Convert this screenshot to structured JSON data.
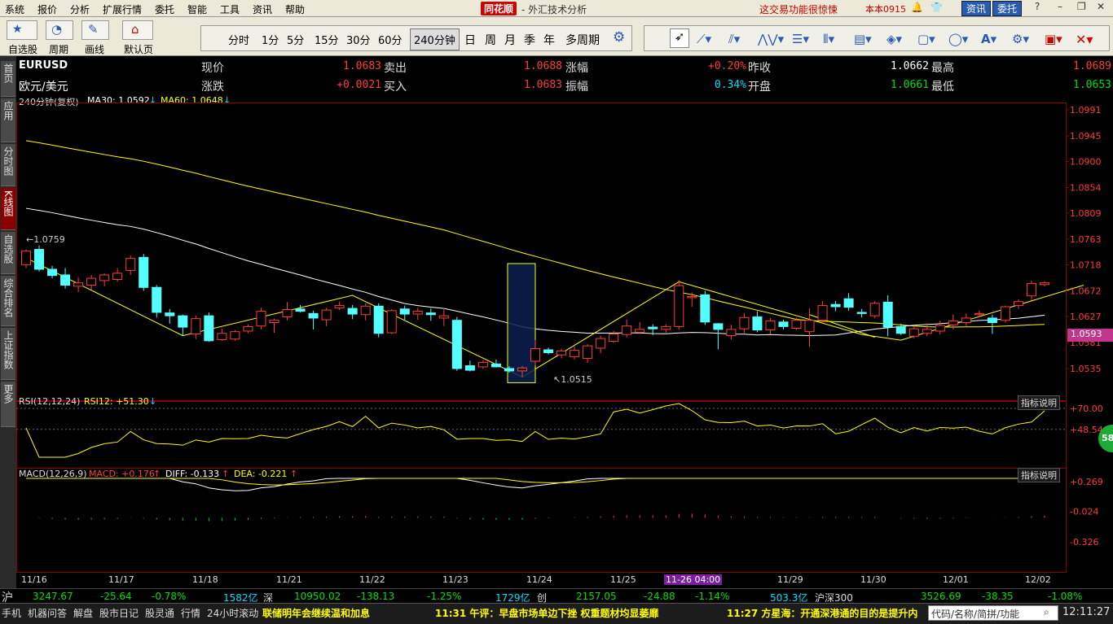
{
  "menubar": {
    "items": [
      "系统",
      "报价",
      "分析",
      "扩展行情",
      "委托",
      "智能",
      "工具",
      "资讯",
      "帮助"
    ],
    "logo": "同花顺",
    "subtitle": "- 外汇技术分析",
    "ad_text": "这交易功能很惊悚",
    "version": "本本0915",
    "btn_news": "资讯",
    "btn_trade": "委托"
  },
  "toolbar": {
    "self_select": "自选股",
    "period": "周期",
    "draw": "画线",
    "default_page": "默认页",
    "periods": [
      "分时",
      "1分",
      "5分",
      "15分",
      "30分",
      "60分",
      "240分钟",
      "日",
      "周",
      "月",
      "季",
      "年",
      "多周期"
    ],
    "active_period": "240分钟"
  },
  "sidebar": {
    "tabs": [
      "首页",
      "应用",
      "分时图",
      "K线图",
      "自选股",
      "综合排名",
      "上证指数",
      "更多"
    ],
    "active": "K线图"
  },
  "quote": {
    "symbol": "EURUSD",
    "name": "欧元/美元",
    "labels": [
      "现价",
      "卖出",
      "涨幅",
      "昨收",
      "最高",
      "涨跌",
      "买入",
      "振幅",
      "开盘",
      "最低"
    ],
    "price": "1.0683",
    "sell": "1.0688",
    "change_pct": "+0.20%",
    "prev_close": "1.0662",
    "high": "1.0689",
    "change": "+0.0021",
    "buy": "1.0683",
    "amplitude": "0.34%",
    "open": "1.0661",
    "low": "1.0653"
  },
  "kline": {
    "header": "240分钟(复权)",
    "ma30": "MA30: 1.0592",
    "ma60": "MA60: 1.0648",
    "marker_high": "1.0759",
    "marker_low": "1.0515",
    "price_ticks": [
      "1.0991",
      "1.0945",
      "1.0900",
      "1.0854",
      "1.0809",
      "1.0763",
      "1.0718",
      "1.0672",
      "1.0627",
      "1.0581",
      "1.0535"
    ],
    "current_price_tag": "1.0593",
    "colors": {
      "up": "#ff3c3c",
      "down": "#54ffff",
      "ma30": "#ffffff",
      "ma60": "#ffff00"
    }
  },
  "rsi": {
    "label": "RSI(12,12,24)",
    "value": "RSI12: +51.30",
    "explain": "指标说明",
    "ticks": [
      "+70.00",
      "+48.54"
    ],
    "badge": "58"
  },
  "macd": {
    "label": "MACD(12,26,9)",
    "macd": "MACD: +0.176",
    "diff": "DIFF: -0.133",
    "dea": "DEA: -0.221",
    "explain": "指标说明",
    "ticks": [
      "+0.269",
      "-0.024",
      "-0.326"
    ]
  },
  "dates": [
    "11/16",
    "11/17",
    "11/18",
    "11/21",
    "11/22",
    "11/23",
    "11/24",
    "11/25",
    "11-26 04:00",
    "11/29",
    "11/30",
    "12/01",
    "12/02"
  ],
  "status1": {
    "sh_label": "沪",
    "sh_index": "3247.67",
    "sh_chg": "-25.64",
    "sh_pct": "-0.78%",
    "sh_amt": "1582亿",
    "sz_label": "深",
    "sz_index": "10950.02",
    "sz_chg": "-138.13",
    "sz_pct": "-1.25%",
    "sz_amt": "1729亿",
    "cy_label": "创",
    "cy_index": "2157.05",
    "cy_chg": "-24.88",
    "cy_pct": "-1.14%",
    "cy_amt": "503.3亿",
    "hs_label": "沪深300",
    "hs_index": "3526.69",
    "hs_chg": "-38.35",
    "hs_pct": "-1.08%"
  },
  "status2": {
    "tabs": [
      "手机",
      "机器问答",
      "解盘",
      "股市日记",
      "股灵通",
      "行情",
      "24小时滚动"
    ],
    "news1": "联储明年会继续温和加息",
    "news2": "11:31 午评：早盘市场单边下挫 权重题材均显萎靡",
    "news3": "11:27 方星海：开通深港通的目的是提升内",
    "search": "代码/名称/简拼/功能",
    "clock": "12:11:27"
  },
  "candles": [
    [
      1.0718,
      1.0745,
      1.0712,
      1.0742
    ],
    [
      1.0745,
      1.0752,
      1.0706,
      1.071
    ],
    [
      1.071,
      1.0716,
      1.0694,
      1.0699
    ],
    [
      1.07,
      1.0712,
      1.0676,
      1.0682
    ],
    [
      1.068,
      1.0696,
      1.067,
      1.0686
    ],
    [
      1.0682,
      1.07,
      1.0674,
      1.0694
    ],
    [
      1.069,
      1.0703,
      1.068,
      1.07
    ],
    [
      1.0692,
      1.0712,
      1.0688,
      1.0703
    ],
    [
      1.0708,
      1.0734,
      1.07,
      1.0729
    ],
    [
      1.0731,
      1.0737,
      1.0672,
      1.0678
    ],
    [
      1.0678,
      1.0682,
      1.0625,
      1.0634
    ],
    [
      1.0633,
      1.064,
      1.0614,
      1.0628
    ],
    [
      1.0628,
      1.063,
      1.0593,
      1.0608
    ],
    [
      1.0596,
      1.0628,
      1.0587,
      1.0623
    ],
    [
      1.0628,
      1.0634,
      1.0582,
      1.0584
    ],
    [
      1.0586,
      1.0605,
      1.0584,
      1.0597
    ],
    [
      1.0587,
      1.0603,
      1.0584,
      1.06
    ],
    [
      1.0601,
      1.0613,
      1.0597,
      1.0609
    ],
    [
      1.061,
      1.0642,
      1.0604,
      1.0636
    ],
    [
      1.0616,
      1.0623,
      1.0598,
      1.062
    ],
    [
      1.0626,
      1.0652,
      1.062,
      1.0639
    ],
    [
      1.064,
      1.0647,
      1.0634,
      1.0636
    ],
    [
      1.0632,
      1.0637,
      1.0604,
      1.0624
    ],
    [
      1.0621,
      1.0642,
      1.061,
      1.0638
    ],
    [
      1.0642,
      1.0653,
      1.0638,
      1.0646
    ],
    [
      1.0641,
      1.0647,
      1.0622,
      1.0631
    ],
    [
      1.063,
      1.065,
      1.062,
      1.0645
    ],
    [
      1.0645,
      1.065,
      1.059,
      1.0597
    ],
    [
      1.0598,
      1.064,
      1.0596,
      1.0637
    ],
    [
      1.064,
      1.0646,
      1.0621,
      1.0631
    ],
    [
      1.0631,
      1.0642,
      1.0621,
      1.0636
    ],
    [
      1.0633,
      1.0641,
      1.0619,
      1.063
    ],
    [
      1.0624,
      1.0642,
      1.061,
      1.0628
    ],
    [
      1.062,
      1.0626,
      1.0531,
      1.0535
    ],
    [
      1.054,
      1.0549,
      1.053,
      1.0532
    ],
    [
      1.0538,
      1.055,
      1.0534,
      1.0546
    ],
    [
      1.0543,
      1.0551,
      1.0537,
      1.0538
    ],
    [
      1.0535,
      1.0539,
      1.0528,
      1.0531
    ],
    [
      1.0531,
      1.0539,
      1.052,
      1.0536
    ],
    [
      1.0548,
      1.0585,
      1.054,
      1.057
    ],
    [
      1.0568,
      1.0572,
      1.056,
      1.0563
    ],
    [
      1.0559,
      1.057,
      1.0553,
      1.0566
    ],
    [
      1.0556,
      1.0574,
      1.0551,
      1.0567
    ],
    [
      1.0553,
      1.0578,
      1.0545,
      1.0575
    ],
    [
      1.0571,
      1.0593,
      1.0562,
      1.0588
    ],
    [
      1.0583,
      1.0601,
      1.058,
      1.0596
    ],
    [
      1.0595,
      1.0621,
      1.059,
      1.061
    ],
    [
      1.0599,
      1.0617,
      1.0597,
      1.0604
    ],
    [
      1.0608,
      1.0613,
      1.0594,
      1.0605
    ],
    [
      1.0604,
      1.0613,
      1.0598,
      1.0609
    ],
    [
      1.0609,
      1.0691,
      1.0603,
      1.0681
    ],
    [
      1.066,
      1.0669,
      1.0644,
      1.0662
    ],
    [
      1.0665,
      1.0672,
      1.0612,
      1.0617
    ],
    [
      1.0614,
      1.0615,
      1.0569,
      1.0604
    ],
    [
      1.0593,
      1.0612,
      1.0586,
      1.0604
    ],
    [
      1.0605,
      1.0633,
      1.0598,
      1.0625
    ],
    [
      1.0626,
      1.0636,
      1.0599,
      1.0603
    ],
    [
      1.0603,
      1.0624,
      1.0596,
      1.0619
    ],
    [
      1.0617,
      1.0621,
      1.0604,
      1.0609
    ],
    [
      1.0606,
      1.0624,
      1.0603,
      1.062
    ],
    [
      1.06,
      1.0641,
      1.0573,
      1.062
    ],
    [
      1.062,
      1.0654,
      1.0615,
      1.0646
    ],
    [
      1.0648,
      1.0654,
      1.0636,
      1.0644
    ],
    [
      1.0658,
      1.0668,
      1.0637,
      1.0643
    ],
    [
      1.0634,
      1.064,
      1.0625,
      1.0632
    ],
    [
      1.0628,
      1.0654,
      1.0624,
      1.065
    ],
    [
      1.0652,
      1.0664,
      1.0592,
      1.0608
    ],
    [
      1.0609,
      1.0614,
      1.0594,
      1.0597
    ],
    [
      1.0592,
      1.061,
      1.0588,
      1.0605
    ],
    [
      1.0597,
      1.0615,
      1.0592,
      1.0604
    ],
    [
      1.0601,
      1.0619,
      1.0595,
      1.0611
    ],
    [
      1.0612,
      1.063,
      1.0604,
      1.0619
    ],
    [
      1.0616,
      1.0632,
      1.061,
      1.0624
    ],
    [
      1.063,
      1.0637,
      1.0626,
      1.0632
    ],
    [
      1.0624,
      1.063,
      1.0596,
      1.0616
    ],
    [
      1.062,
      1.0646,
      1.0616,
      1.0644
    ],
    [
      1.0646,
      1.0657,
      1.064,
      1.0653
    ],
    [
      1.0663,
      1.069,
      1.0656,
      1.0685
    ],
    [
      1.0683,
      1.0689,
      1.068,
      1.0686
    ]
  ]
}
